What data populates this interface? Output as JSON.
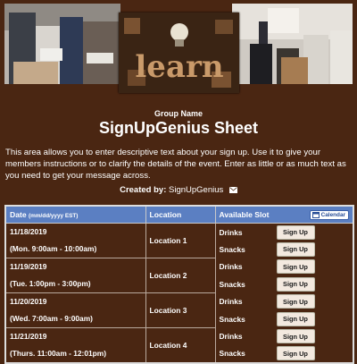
{
  "banner": {
    "left_photo": "people-seated-photo",
    "center_photo": "learn-letters-photo",
    "center_word": "learn",
    "right_photo": "classroom-presentation-photo"
  },
  "header": {
    "group_name": "Group Name",
    "title": "SignUpGenius Sheet",
    "description": "This area allows you to enter descriptive text about your sign up. Use it to give your members instructions or to clarify the details of the event. Enter as little or as much text as you need to get your message across.",
    "created_by_label": "Created by:",
    "created_by_name": "SignUpGenius"
  },
  "table": {
    "col_date": "Date",
    "col_date_hint": "(mm/dd/yyyy EST)",
    "col_location": "Location",
    "col_slot": "Available Slot",
    "calendar_label": "Calendar",
    "rows": [
      {
        "date": "11/18/2019",
        "time": "(Mon. 9:00am - 10:00am)",
        "location": "Location 1",
        "slot1": "Drinks",
        "slot2": "Snacks",
        "btn": "Sign Up"
      },
      {
        "date": "11/19/2019",
        "time": "(Tue. 1:00pm - 3:00pm)",
        "location": "Location 2",
        "slot1": "Drinks",
        "slot2": "Snacks",
        "btn": "Sign Up"
      },
      {
        "date": "11/20/2019",
        "time": "(Wed. 7:00am - 9:00am)",
        "location": "Location 3",
        "slot1": "Drinks",
        "slot2": "Snacks",
        "btn": "Sign Up"
      },
      {
        "date": "11/21/2019",
        "time": "(Thurs. 11:00am - 12:01pm)",
        "location": "Location 4",
        "slot1": "Drinks",
        "slot2": "Snacks",
        "btn": "Sign Up"
      }
    ]
  },
  "colors": {
    "background": "#4a2612",
    "table_header": "#5b7fc2",
    "button": "#f3e9df"
  }
}
